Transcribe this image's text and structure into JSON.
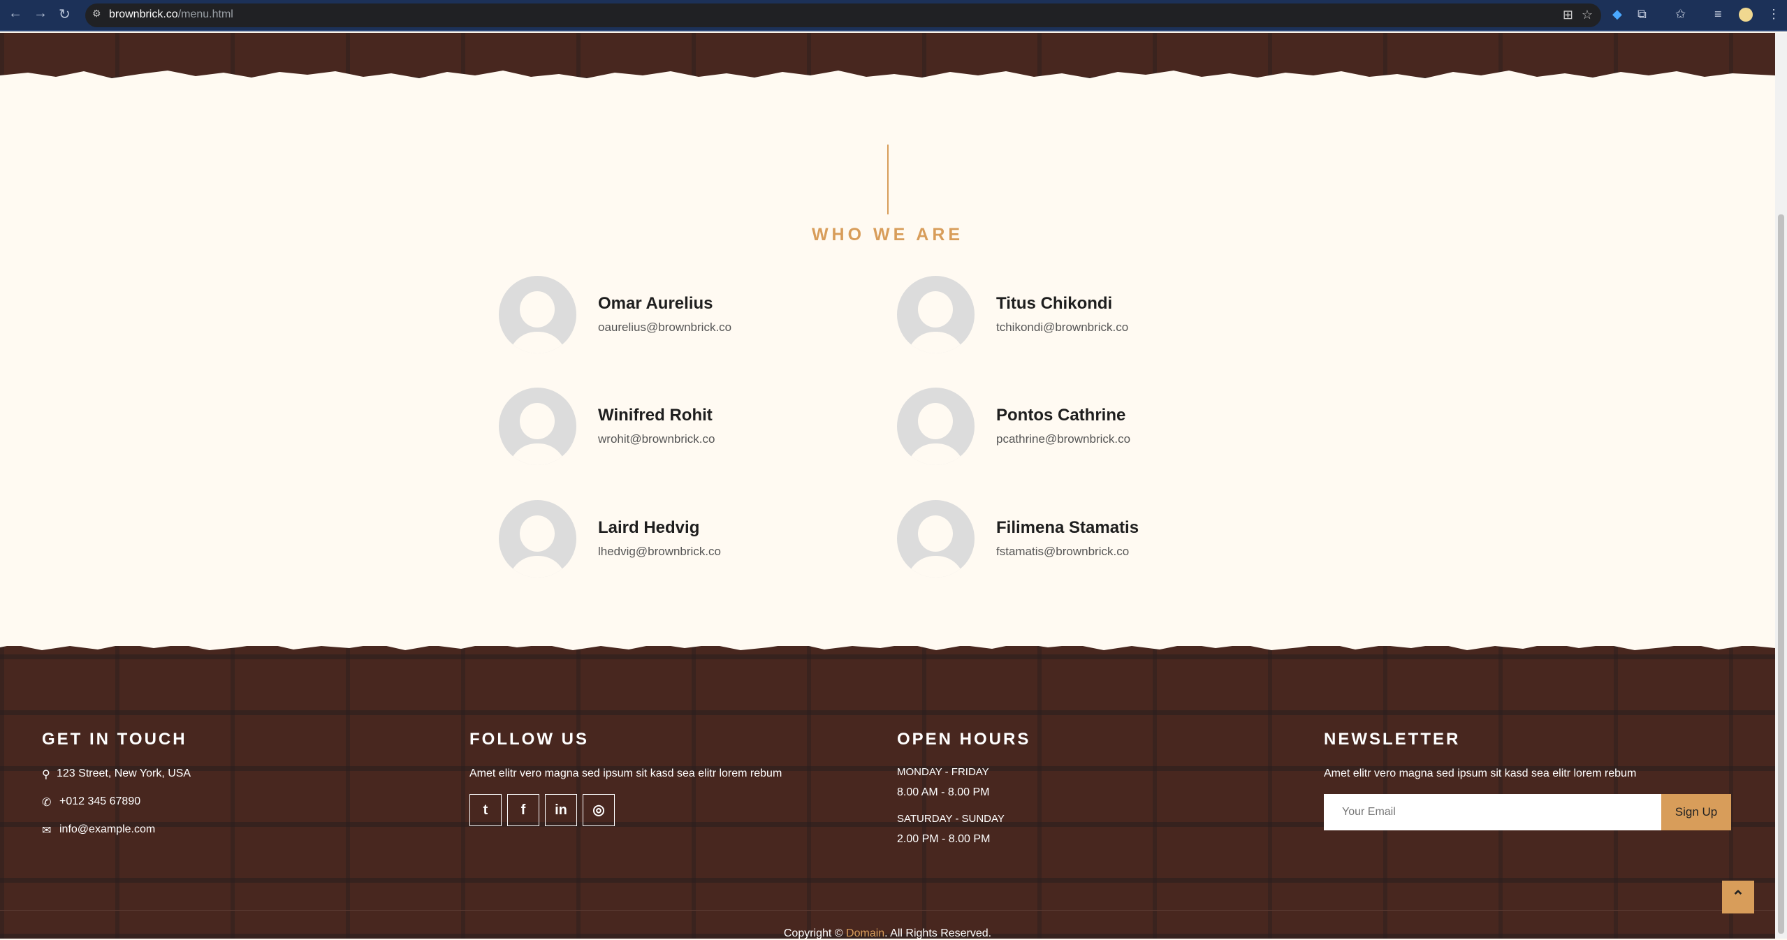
{
  "browser": {
    "url_host": "brownbrick.co",
    "url_path": "/menu.html"
  },
  "section": {
    "title": "WHO WE ARE"
  },
  "team": [
    {
      "name": "Omar Aurelius",
      "email": "oaurelius@brownbrick.co"
    },
    {
      "name": "Titus Chikondi",
      "email": "tchikondi@brownbrick.co"
    },
    {
      "name": "Winifred Rohit",
      "email": "wrohit@brownbrick.co"
    },
    {
      "name": "Pontos Cathrine",
      "email": "pcathrine@brownbrick.co"
    },
    {
      "name": "Laird Hedvig",
      "email": "lhedvig@brownbrick.co"
    },
    {
      "name": "Filimena Stamatis",
      "email": "fstamatis@brownbrick.co"
    }
  ],
  "footer": {
    "contact": {
      "heading": "GET IN TOUCH",
      "address": "123 Street, New York, USA",
      "phone": "+012 345 67890",
      "email": "info@example.com"
    },
    "follow": {
      "heading": "FOLLOW US",
      "text": "Amet elitr vero magna sed ipsum sit kasd sea elitr lorem rebum"
    },
    "hours": {
      "heading": "OPEN HOURS",
      "weekday_label": "MONDAY - FRIDAY",
      "weekday_hours": "8.00 AM - 8.00 PM",
      "weekend_label": "SATURDAY - SUNDAY",
      "weekend_hours": "2.00 PM - 8.00 PM"
    },
    "newsletter": {
      "heading": "NEWSLETTER",
      "text": "Amet elitr vero magna sed ipsum sit kasd sea elitr lorem rebum",
      "placeholder": "Your Email",
      "button": "Sign Up"
    },
    "copyright": {
      "prefix": "Copyright © ",
      "link": "Domain",
      "suffix": ". All Rights Reserved."
    }
  },
  "colors": {
    "accent": "#d89d5a",
    "cream": "#fffaf2",
    "brick": "#48271f"
  }
}
